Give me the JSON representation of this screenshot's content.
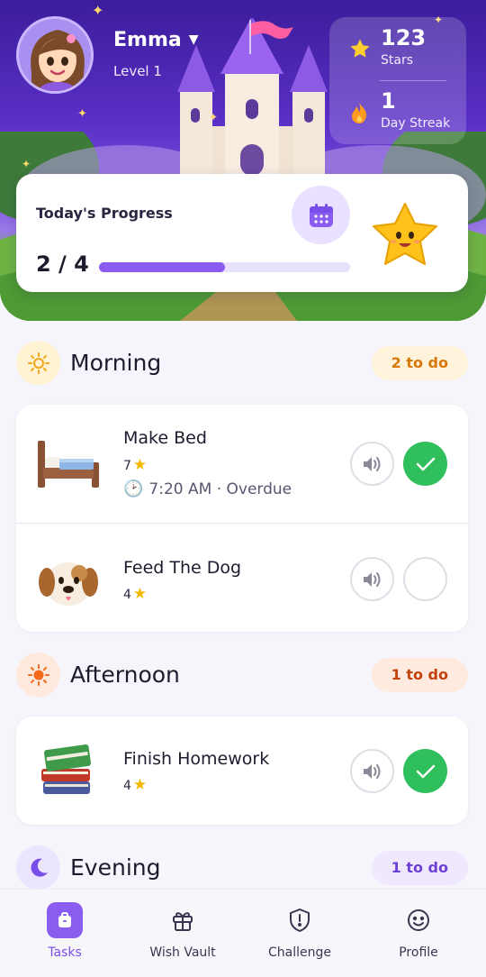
{
  "user": {
    "name": "Emma",
    "level": "Level 1"
  },
  "stats": [
    {
      "value": "123",
      "label": "Stars",
      "icon": "star-icon"
    },
    {
      "value": "1",
      "label": "Day Streak",
      "icon": "flame-icon"
    }
  ],
  "progress": {
    "title": "Today's Progress",
    "count": "2 / 4",
    "completed": 2,
    "total": 4
  },
  "sections": {
    "morning": {
      "title": "Morning",
      "badge": "2 to do"
    },
    "afternoon": {
      "title": "Afternoon",
      "badge": "1 to do"
    },
    "evening": {
      "title": "Evening",
      "badge": "1 to do"
    }
  },
  "tasks": {
    "make_bed": {
      "name": "Make Bed",
      "stars": "7",
      "time": "7:20 AM · Overdue",
      "done": true
    },
    "feed_dog": {
      "name": "Feed The Dog",
      "stars": "4",
      "done": false
    },
    "homework": {
      "name": "Finish Homework",
      "stars": "4",
      "done": true
    }
  },
  "nav": [
    {
      "label": "Tasks",
      "icon": "tasks-icon",
      "active": true
    },
    {
      "label": "Wish Vault",
      "icon": "gift-icon",
      "active": false
    },
    {
      "label": "Challenge",
      "icon": "shield-icon",
      "active": false
    },
    {
      "label": "Profile",
      "icon": "smile-icon",
      "active": false
    }
  ],
  "colors": {
    "accent": "#8a5cf0",
    "done_green": "#2fbf5c",
    "morning_badge_bg": "#fff3dc",
    "morning_badge_text": "#d97706",
    "afternoon_badge_bg": "#ffeadf",
    "afternoon_badge_text": "#c2410c",
    "evening_badge_bg": "#efe8ff",
    "evening_badge_text": "#6d3fd6"
  }
}
